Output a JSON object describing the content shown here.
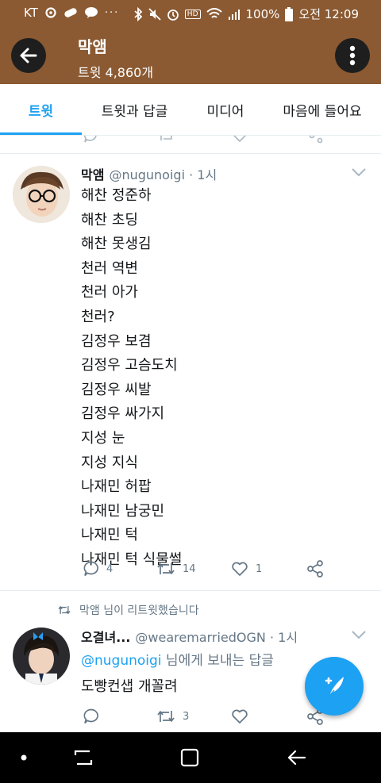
{
  "status_bar": {
    "carrier": "KT",
    "battery": "100%",
    "time": "오전 12:09",
    "icon_names": [
      "settings-icon",
      "pill-icon",
      "talk-icon",
      "more-dots-icon",
      "bluetooth-icon",
      "mute-icon",
      "alarm-icon",
      "hd-icon",
      "wifi-icon",
      "signal-icon",
      "battery-icon"
    ]
  },
  "header": {
    "title": "막앰",
    "subtitle": "트윗 4,860개"
  },
  "tabs": [
    {
      "label": "트윗",
      "active": true
    },
    {
      "label": "트윗과 답글",
      "active": false
    },
    {
      "label": "미디어",
      "active": false
    },
    {
      "label": "마음에 들어요",
      "active": false
    }
  ],
  "tweet1": {
    "name": "막앰",
    "handle": "@nugunoigi · 1시",
    "lines": [
      "해찬 정준하",
      "해찬 초딩",
      "해찬 못생김",
      "천러 역변",
      "천러 아가",
      "천러?",
      "김정우 보겸",
      "김정우 고슴도치",
      "김정우 씨발",
      "김정우 싸가지",
      "지성 눈",
      "지성 지식",
      "나재민 허팝",
      "나재민 남궁민",
      "나재민 턱",
      "나재민 턱 식물썰"
    ],
    "replies": "4",
    "retweets": "14",
    "likes": "1"
  },
  "retweet_note": "막앰 님이 리트윗했습니다",
  "tweet2": {
    "name": "오결녀...",
    "handle": "@wearemarriedOGN · 1시",
    "reply_mention": "@nugunoigi",
    "reply_suffix": " 님에게 보내는 답글",
    "text": "도빵컨샙 개꼴려",
    "replies": "",
    "retweets": "3",
    "likes": ""
  },
  "colors": {
    "header_brown": "#8b5a32",
    "accent_blue": "#1da1f2",
    "muted_gray": "#657786"
  }
}
